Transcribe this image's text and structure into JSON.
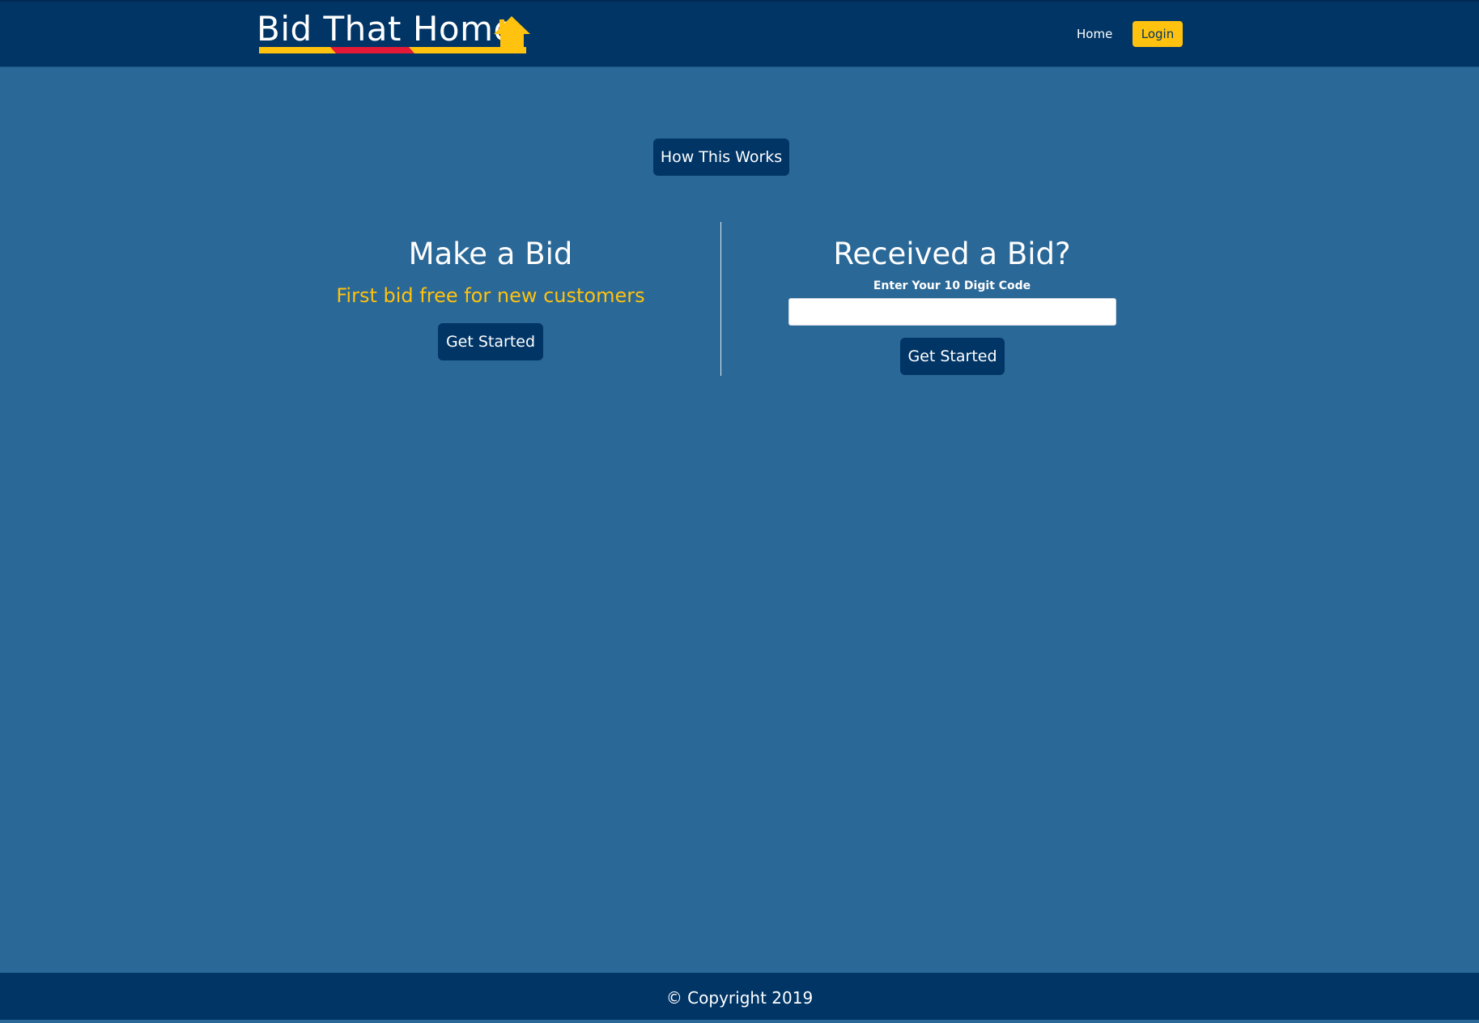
{
  "header": {
    "brand": "Bid That Home",
    "nav": {
      "home_label": "Home",
      "login_label": "Login"
    }
  },
  "main": {
    "how_button_label": "How This Works",
    "make_bid": {
      "title": "Make a Bid",
      "promo": "First bid free for new customers",
      "button_label": "Get Started"
    },
    "received_bid": {
      "title": "Received a Bid?",
      "code_label": "Enter Your 10 Digit Code",
      "code_value": "",
      "code_placeholder": "",
      "button_label": "Get Started"
    }
  },
  "footer": {
    "copyright": "© Copyright 2019"
  },
  "colors": {
    "nav_bg": "#003566",
    "page_bg": "#2a6897",
    "accent_yellow": "#ffc20e",
    "accent_red": "#e31937"
  },
  "icons": {
    "logo_icon": "house-icon"
  }
}
